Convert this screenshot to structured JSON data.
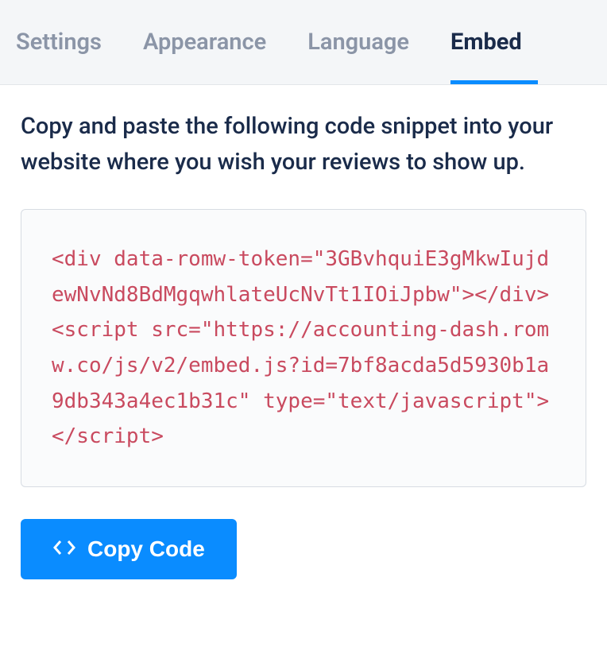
{
  "tabs": {
    "settings": "Settings",
    "appearance": "Appearance",
    "language": "Language",
    "embed": "Embed"
  },
  "instruction": "Copy and paste the following code snippet into your website where you wish your reviews to show up.",
  "code_snippet": "<div data-romw-token=\"3GBvhquiE3gMkwIujdewNvNd8BdMgqwhlateUcNvTt1IOiJpbw\"></div>\n<script src=\"https://accounting-dash.romw.co/js/v2/embed.js?id=7bf8acda5d5930b1a9db343a4ec1b31c\" type=\"text/javascript\"></script>",
  "copy_button": "Copy Code"
}
